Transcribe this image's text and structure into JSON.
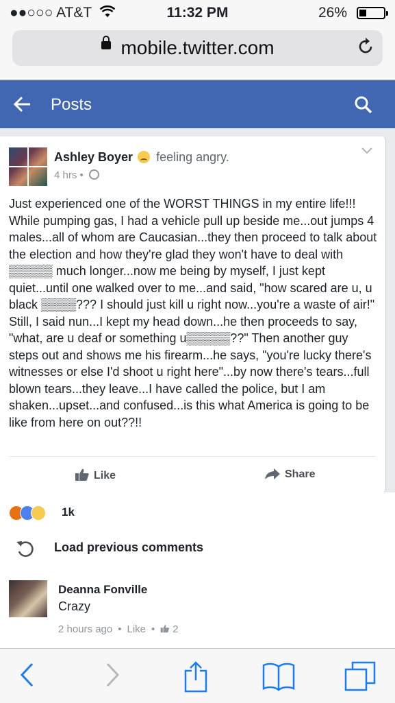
{
  "status_bar": {
    "carrier": "●●○○○ AT&T",
    "time": "11:32 PM",
    "battery": "26%",
    "battery_level": 0.26
  },
  "browser": {
    "url": "mobile.twitter.com"
  },
  "header": {
    "title": "Posts"
  },
  "post": {
    "author": "Ashley Boyer",
    "feeling": "feeling angry.",
    "time": "4 hrs",
    "paragraph": "Just experienced one of the WORST THINGS in my entire life!!! While pumping gas, I had a vehicle pull up beside me...out jumps 4 males...all of whom are Caucasian...they then proceed to talk about the election and how they're glad they won't have to deal with ▒▒▒▒▒ much longer...now me being by myself, I just kept quiet...until one walked over to me...and said, \"how scared are u, u black ▒▒▒▒??? I should just kill u right now...you're a waste of air!\" Still, I said nun...I kept my head down...he then proceeds to say, \"what, are u deaf or something u▒▒▒▒▒??\" Then another guy steps out and shows me his firearm...he says, \"you're lucky there's witnesses or else I'd shoot u right here\"...by now there's tears...full blown tears...they leave...I have called the police, but I am shaken...upset...and confused...is this what America is going to be like from here on out??!!",
    "like_label": "Like",
    "share_label": "Share"
  },
  "reactions": {
    "count": "1k",
    "icons": [
      "angry-icon",
      "like-icon",
      "sad-icon"
    ]
  },
  "comments": {
    "load_previous": "Load previous comments",
    "items": [
      {
        "name": "Deanna Fonville",
        "text": "Crazy",
        "time": "2 hours ago",
        "like": "Like",
        "likes": "2"
      }
    ]
  },
  "colors": {
    "facebook_blue": "#4267b2",
    "ios_blue": "#1a7cf5"
  }
}
